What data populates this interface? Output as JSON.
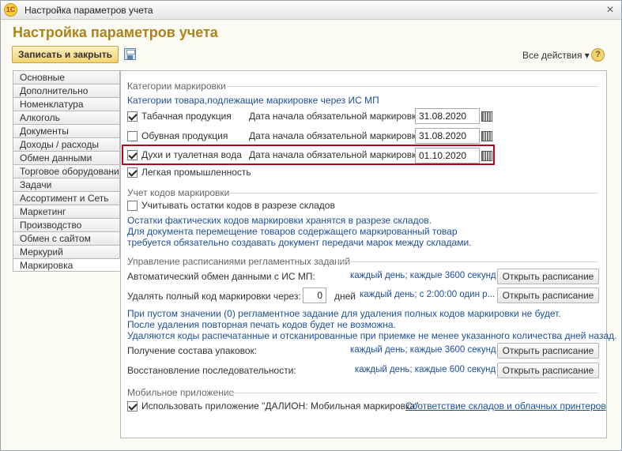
{
  "window": {
    "title": "Настройка параметров учета",
    "logo": "1С"
  },
  "page_title": "Настройка параметров учета",
  "toolbar": {
    "save_close_label": "Записать и закрыть",
    "all_actions_label": "Все действия ▾",
    "help_label": "?"
  },
  "sidebar": {
    "items": [
      "Основные",
      "Дополнительно",
      "Номенклатура",
      "Алкоголь",
      "Документы",
      "Доходы / расходы",
      "Обмен данными",
      "Торговое оборудование",
      "Задачи",
      "Ассортимент и Сеть",
      "Маркетинг",
      "Производство",
      "Обмен с сайтом",
      "Меркурий",
      "Маркировка"
    ],
    "active": "Маркировка"
  },
  "marking_categories": {
    "heading": "Категории маркировки",
    "subheading": "Категории товара,подлежащие маркировке через ИС МП",
    "date_label": "Дата начала обязательной маркировки:",
    "rows": [
      {
        "label": "Табачная продукция",
        "checked": true,
        "date": "31.08.2020"
      },
      {
        "label": "Обувная продукция",
        "checked": false,
        "date": "31.08.2020"
      },
      {
        "label": "Духи и туалетная вода",
        "checked": true,
        "date": "01.10.2020"
      },
      {
        "label": "Легкая промышленность",
        "checked": true
      }
    ]
  },
  "codes_accounting": {
    "heading": "Учет кодов маркировки",
    "checkbox_label": "Учитывать остатки кодов в разрезе складов",
    "checked": false,
    "notes": [
      "Остатки фактических кодов маркировки хранятся в разрезе складов.",
      "Для документа перемещение товаров содержащего маркированный товар",
      "требуется обязательно создавать документ передачи марок между складами."
    ]
  },
  "schedules": {
    "heading": "Управление расписаниями регламентных заданий",
    "open_label": "Открыть расписание",
    "auto_exchange": {
      "label": "Автоматический обмен данными с ИС МП:",
      "schedule": "каждый день; каждые 3600 секунд"
    },
    "delete_codes": {
      "label": "Удалять полный код маркировки через:",
      "value": "0",
      "unit": "дней",
      "schedule": "каждый день; с 2:00:00 один р..."
    },
    "notes": [
      "При пустом значении (0) регламентное задание для удаления полных кодов маркировки не будет.",
      "После удаления повторная печать кодов будет не возможна.",
      "Удаляются коды распечатанные и отсканированные при приемке не менее указанного количества дней назад."
    ],
    "packages": {
      "label": "Получение состава упаковок:",
      "schedule": "каждый день; каждые 3600 секунд"
    },
    "sequence": {
      "label": "Восстановление последовательности:",
      "schedule": "каждый день; каждые 600 секунд"
    }
  },
  "mobile": {
    "heading": "Мобильное приложение",
    "checkbox_label": "Использовать приложение \"ДАЛИОН: Мобильная маркировка\"",
    "checked": true,
    "link": "Соответствие складов и облачных принтеров"
  }
}
